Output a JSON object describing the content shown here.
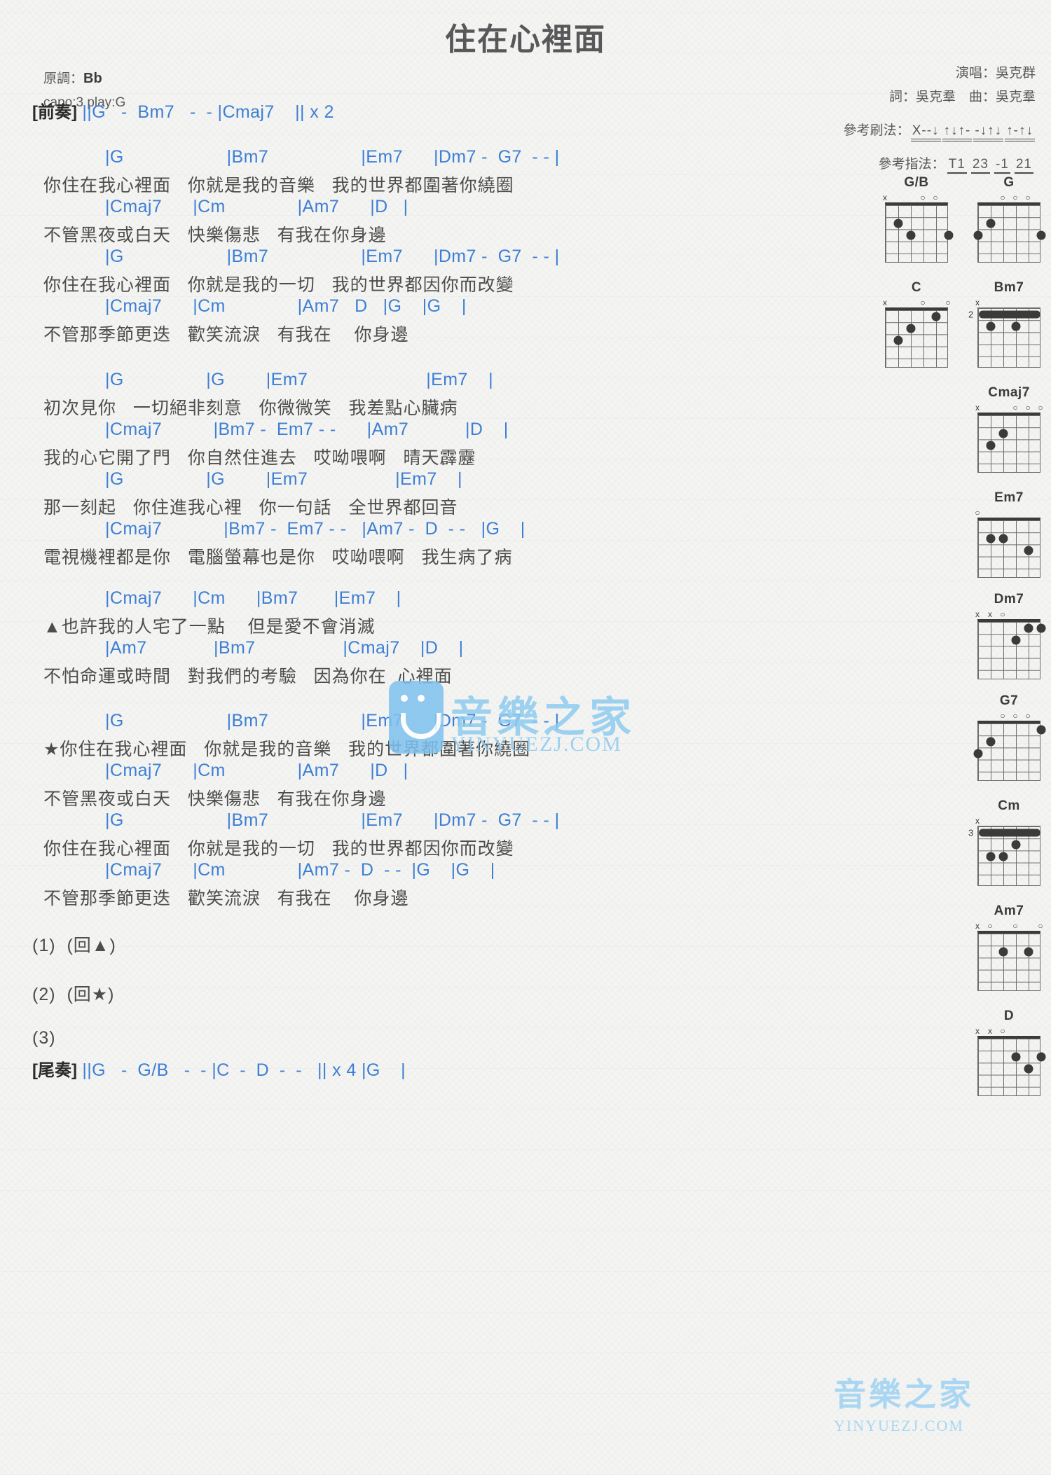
{
  "header": {
    "title": "住在心裡面",
    "original_key_label": "原調：",
    "original_key": "Bb",
    "capo": "capo:3 play:G",
    "singer": "演唱：吳克群",
    "writer": "詞：吳克羣　曲：吳克羣",
    "strum_label": "參考刷法：",
    "strum_groups": [
      "X--↓",
      "↑↓↑-",
      "-↓↑↓",
      "↑-↑↓"
    ],
    "finger_label": "參考指法：",
    "finger_groups": [
      "T1",
      "23",
      "-1",
      "21"
    ]
  },
  "intro": {
    "tag": "[前奏]",
    "line": "||G   -  Bm7   -  - |Cmaj7    || x 2"
  },
  "sections": [
    {
      "id": "verse1",
      "lines": [
        {
          "type": "chord",
          "text": "|G                    |Bm7                  |Em7      |Dm7 -  G7  - - |"
        },
        {
          "type": "lyric",
          "text": "你住在我心裡面   你就是我的音樂   我的世界都圍著你繞圈"
        },
        {
          "type": "chord",
          "text": "|Cmaj7      |Cm              |Am7      |D   |"
        },
        {
          "type": "lyric",
          "text": "不管黑夜或白天   快樂傷悲   有我在你身邊"
        },
        {
          "type": "chord",
          "text": "|G                    |Bm7                  |Em7      |Dm7 -  G7  - - |"
        },
        {
          "type": "lyric",
          "text": "你住在我心裡面   你就是我的一切   我的世界都因你而改變"
        },
        {
          "type": "chord",
          "text": "|Cmaj7      |Cm              |Am7   D   |G    |G    |"
        },
        {
          "type": "lyric",
          "text": "不管那季節更迭   歡笑流淚   有我在    你身邊"
        }
      ]
    },
    {
      "id": "verse2",
      "lines": [
        {
          "type": "chord",
          "text": "|G                |G        |Em7                       |Em7    |"
        },
        {
          "type": "lyric",
          "text": "初次見你   一切絕非刻意   你微微笑   我差點心臟病"
        },
        {
          "type": "chord",
          "text": "|Cmaj7          |Bm7 -  Em7 - -      |Am7           |D    |"
        },
        {
          "type": "lyric",
          "text": "我的心它開了門   你自然住進去   哎呦喂啊   晴天霹靂"
        },
        {
          "type": "chord",
          "text": "|G                |G        |Em7                 |Em7    |"
        },
        {
          "type": "lyric",
          "text": "那一刻起   你住進我心裡   你一句話   全世界都回音"
        },
        {
          "type": "chord",
          "text": "|Cmaj7            |Bm7 -  Em7 - -   |Am7 -  D  - -   |G    |"
        },
        {
          "type": "lyric",
          "text": "電視機裡都是你   電腦螢幕也是你   哎呦喂啊   我生病了病"
        }
      ]
    },
    {
      "id": "bridge",
      "lines": [
        {
          "type": "chord",
          "text": "|Cmaj7      |Cm      |Bm7       |Em7    |"
        },
        {
          "type": "lyric",
          "text": "▲也許我的人宅了一點    但是愛不會消滅"
        },
        {
          "type": "chord",
          "text": "|Am7             |Bm7                 |Cmaj7    |D    |"
        },
        {
          "type": "lyric",
          "text": "不怕命運或時間   對我們的考驗   因為你在  心裡面"
        }
      ]
    },
    {
      "id": "chorus",
      "lines": [
        {
          "type": "chord",
          "text": "|G                    |Bm7                  |Em7      |Dm7 -  G7  - - |"
        },
        {
          "type": "lyric",
          "text": "★你住在我心裡面   你就是我的音樂   我的世界都圍著你繞圈"
        },
        {
          "type": "chord",
          "text": "|Cmaj7      |Cm              |Am7      |D   |"
        },
        {
          "type": "lyric",
          "text": "不管黑夜或白天   快樂傷悲   有我在你身邊"
        },
        {
          "type": "chord",
          "text": "|G                    |Bm7                  |Em7      |Dm7 -  G7  - - |"
        },
        {
          "type": "lyric",
          "text": "你住在我心裡面   你就是我的一切   我的世界都因你而改變"
        },
        {
          "type": "chord",
          "text": "|Cmaj7      |Cm              |Am7 -  D  - -  |G    |G    |"
        },
        {
          "type": "lyric",
          "text": "不管那季節更迭   歡笑流淚   有我在    你身邊"
        }
      ]
    }
  ],
  "endings": [
    {
      "label": "(1)",
      "text": "(回▲)"
    },
    {
      "label": "(2)",
      "text": "(回★)"
    },
    {
      "label": "(3)",
      "text": ""
    }
  ],
  "outro": {
    "tag": "[尾奏]",
    "line": "||G   -  G/B   -  - |C  -  D  -  -   || x 4 |G    |"
  },
  "chord_diagrams": [
    {
      "name": "G/B",
      "markers": "x",
      "base_fret": null,
      "dots": [
        [
          2,
          5
        ],
        [
          3,
          4
        ],
        [
          3,
          1
        ]
      ],
      "opens": [
        3,
        2
      ],
      "muted": [
        6
      ]
    },
    {
      "name": "G",
      "markers": "",
      "base_fret": null,
      "dots": [
        [
          2,
          5
        ],
        [
          3,
          6
        ],
        [
          3,
          1
        ]
      ],
      "opens": [
        4,
        3,
        2
      ],
      "muted": []
    },
    {
      "name": "C",
      "markers": "x",
      "base_fret": null,
      "dots": [
        [
          1,
          2
        ],
        [
          2,
          4
        ],
        [
          3,
          5
        ]
      ],
      "opens": [
        3,
        1
      ],
      "muted": [
        6
      ]
    },
    {
      "name": "Bm7",
      "markers": "x",
      "base_fret": "2",
      "barre": 1,
      "dots": [
        [
          2,
          3
        ],
        [
          2,
          5
        ]
      ],
      "opens": [],
      "muted": [
        6
      ]
    },
    {
      "name": "Cmaj7",
      "markers": "",
      "base_fret": null,
      "dots": [
        [
          2,
          4
        ],
        [
          3,
          5
        ]
      ],
      "opens": [
        3,
        2,
        1
      ],
      "muted": [
        6
      ]
    },
    {
      "name": "Em7",
      "markers": "",
      "base_fret": null,
      "dots": [
        [
          2,
          5
        ],
        [
          2,
          4
        ],
        [
          3,
          2
        ]
      ],
      "opens": [
        6
      ],
      "muted": []
    },
    {
      "name": "Dm7",
      "markers": "x",
      "base_fret": null,
      "dots": [
        [
          1,
          1
        ],
        [
          1,
          2
        ],
        [
          2,
          3
        ]
      ],
      "opens": [
        4
      ],
      "muted": [
        6,
        5
      ]
    },
    {
      "name": "G7",
      "markers": "",
      "base_fret": null,
      "dots": [
        [
          1,
          1
        ],
        [
          2,
          5
        ],
        [
          3,
          6
        ]
      ],
      "opens": [
        4,
        3,
        2
      ],
      "muted": []
    },
    {
      "name": "Cm",
      "markers": "x",
      "base_fret": "3",
      "barre": 1,
      "dots": [
        [
          2,
          3
        ],
        [
          3,
          4
        ],
        [
          3,
          5
        ]
      ],
      "opens": [],
      "muted": [
        6
      ]
    },
    {
      "name": "Am7",
      "markers": "",
      "base_fret": null,
      "dots": [
        [
          2,
          4
        ],
        [
          2,
          2
        ]
      ],
      "opens": [
        5,
        3,
        1
      ],
      "muted": [
        6
      ]
    },
    {
      "name": "D",
      "markers": "x",
      "base_fret": null,
      "dots": [
        [
          2,
          3
        ],
        [
          2,
          1
        ],
        [
          3,
          2
        ]
      ],
      "opens": [
        4
      ],
      "muted": [
        6,
        5
      ]
    }
  ],
  "watermark": {
    "cn": "音樂之家",
    "en": "YINYUEZJ.COM"
  }
}
